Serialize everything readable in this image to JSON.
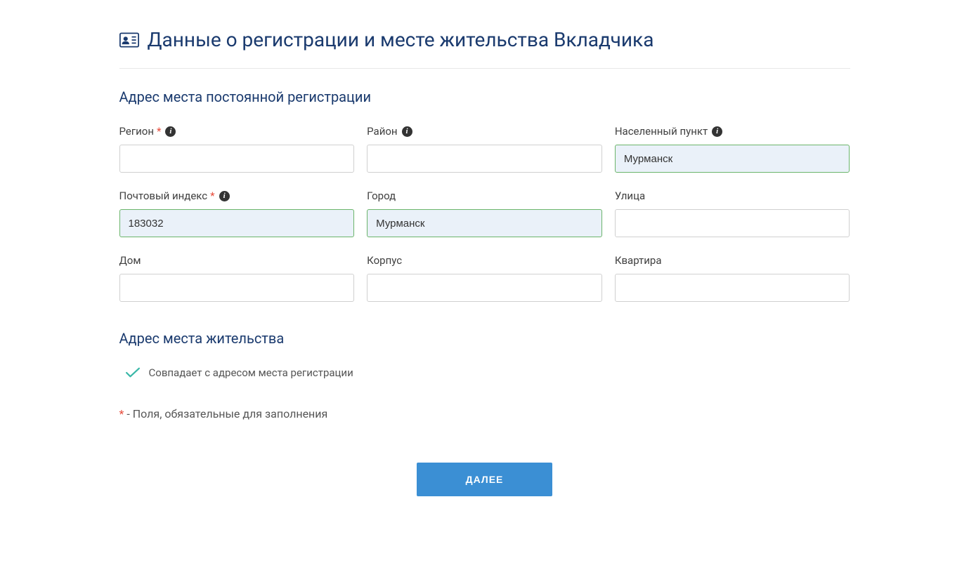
{
  "header": {
    "title": "Данные о регистрации и месте жительства Вкладчика"
  },
  "section1": {
    "title": "Адрес места постоянной регистрации"
  },
  "fields": {
    "region": {
      "label": "Регион",
      "value": ""
    },
    "district": {
      "label": "Район",
      "value": ""
    },
    "locality": {
      "label": "Населенный пункт",
      "value": "Мурманск"
    },
    "postal": {
      "label": "Почтовый индекс",
      "value": "183032"
    },
    "city": {
      "label": "Город",
      "value": "Мурманск"
    },
    "street": {
      "label": "Улица",
      "value": ""
    },
    "house": {
      "label": "Дом",
      "value": ""
    },
    "building": {
      "label": "Корпус",
      "value": ""
    },
    "apartment": {
      "label": "Квартира",
      "value": ""
    }
  },
  "section2": {
    "title": "Адрес места жительства"
  },
  "checkbox": {
    "label": "Совпадает с адресом места регистрации"
  },
  "requiredNote": {
    "prefix": "*",
    "text": " - Поля, обязательные для заполнения"
  },
  "buttons": {
    "next": "ДАЛЕЕ"
  }
}
